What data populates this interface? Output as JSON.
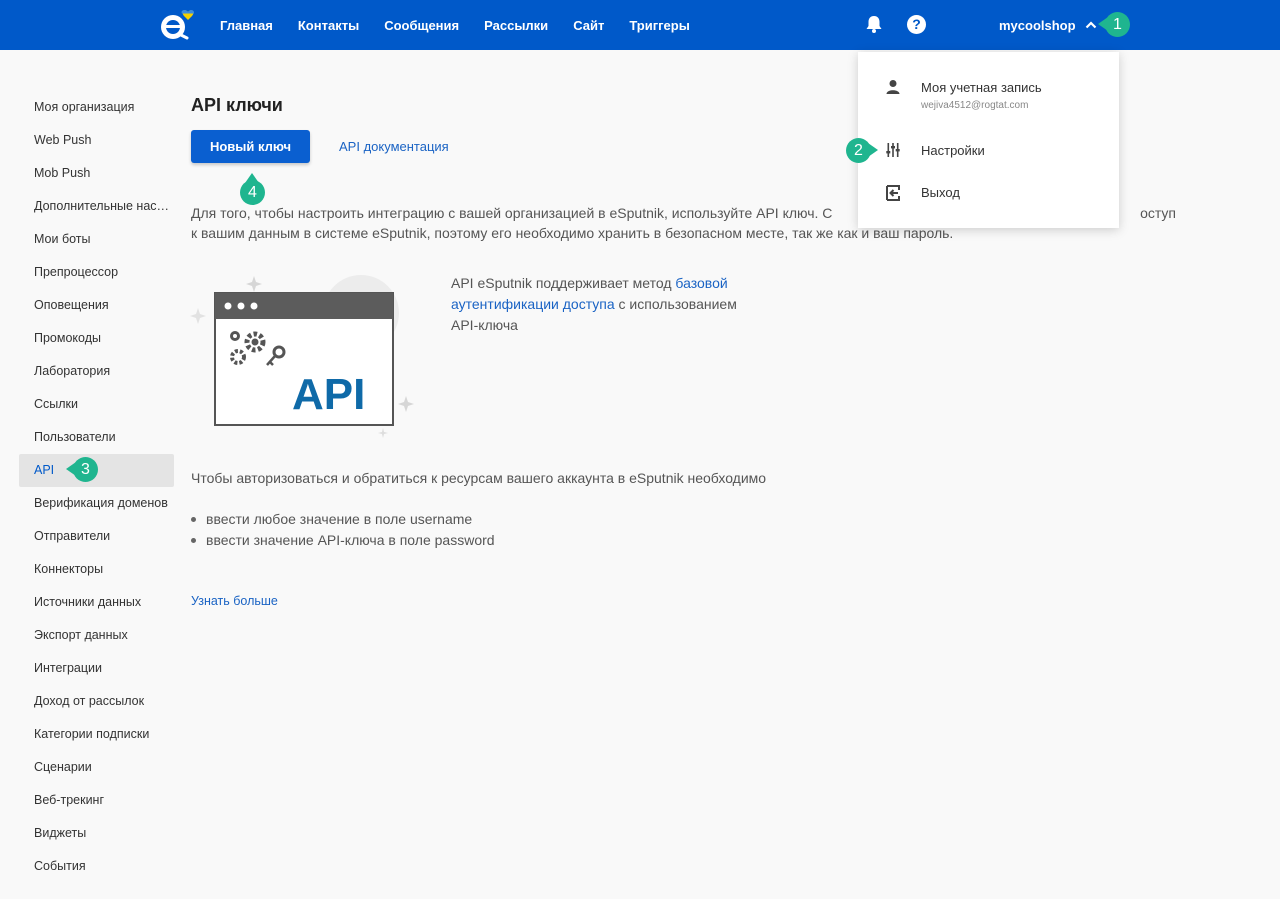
{
  "topbar": {
    "nav": [
      "Главная",
      "Контакты",
      "Сообщения",
      "Рассылки",
      "Сайт",
      "Триггеры"
    ],
    "username": "mycoolshop",
    "help_glyph": "?"
  },
  "account_menu": {
    "account_label": "Моя учетная запись",
    "email": "wejiva4512@rogtat.com",
    "settings_label": "Настройки",
    "logout_label": "Выход"
  },
  "sidebar": {
    "items": [
      "Моя организация",
      "Web Push",
      "Mob Push",
      "Дополнительные настройки",
      "Мои боты",
      "Препроцессор",
      "Оповещения",
      "Промокоды",
      "Лаборатория",
      "Ссылки",
      "Пользователи",
      "API",
      "Верификация доменов",
      "Отправители",
      "Коннекторы",
      "Источники данных",
      "Экспорт данных",
      "Интеграции",
      "Доход от рассылок",
      "Категории подписки",
      "Сценарии",
      "Веб-трекинг",
      "Виджеты",
      "События"
    ],
    "active_index": 11
  },
  "main": {
    "title": "API ключи",
    "new_key_button": "Новый ключ",
    "docs_link": "API документация",
    "description_1": "Для того, чтобы настроить интеграцию с вашей организацией в eSputnik, используйте API ключ. С",
    "description_2": "оступ",
    "description_3": "к вашим данным в системе eSputnik, поэтому его необходимо хранить в безопасном месте, так же как и ваш пароль.",
    "api_label": "API",
    "api_info_1": "API eSputnik поддерживает метод ",
    "api_info_link_1": "базовой",
    "api_info_link_2": "аутентификации доступа",
    "api_info_2": " с использованием",
    "api_info_3": "API-ключа",
    "auth_title": "Чтобы авторизоваться и обратиться к ресурсам вашего аккаунта в eSputnik необходимо",
    "bullets": [
      "ввести любое значение в поле username",
      "ввести значение API-ключа в поле password"
    ],
    "learn_more": "Узнать больше"
  },
  "markers": [
    "1",
    "2",
    "3",
    "4"
  ],
  "colors": {
    "brand_blue": "#0059c9",
    "button_blue": "#0a5fd0",
    "link_blue": "#1a63c4",
    "marker_green": "#1fb58f",
    "api_blue": "#0f6aa8"
  }
}
